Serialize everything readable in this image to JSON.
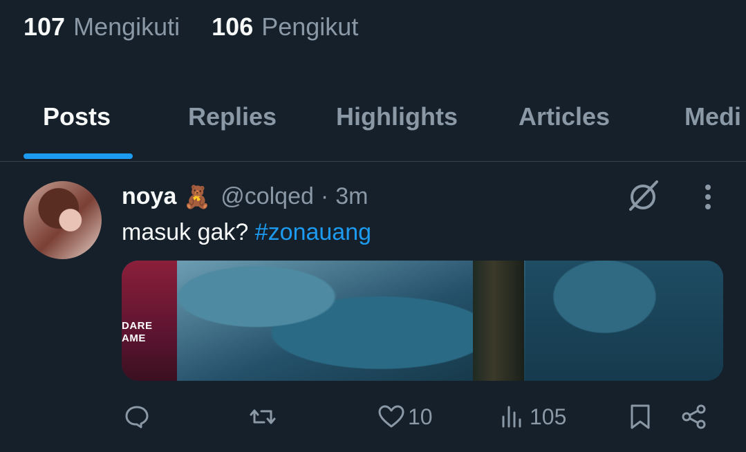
{
  "profile": {
    "following_count": "107",
    "following_label": "Mengikuti",
    "followers_count": "106",
    "followers_label": "Pengikut"
  },
  "tabs": [
    {
      "label": "Posts",
      "active": true
    },
    {
      "label": "Replies",
      "active": false
    },
    {
      "label": "Highlights",
      "active": false
    },
    {
      "label": "Articles",
      "active": false
    },
    {
      "label": "Medi",
      "active": false
    }
  ],
  "post": {
    "display_name": "noya",
    "name_emoji": "🧸",
    "handle": "@colqed",
    "separator": "·",
    "time": "3m",
    "text": "masuk gak? ",
    "hashtag": "#zonauang",
    "media_overlay_text_line1": "DARE",
    "media_overlay_text_line2": "AME",
    "likes": "10",
    "views": "105"
  },
  "icons": {
    "grok": "grok-icon",
    "more": "more-icon",
    "reply": "reply-icon",
    "repost": "repost-icon",
    "like": "heart-icon",
    "views": "views-icon",
    "bookmark": "bookmark-icon",
    "share": "share-icon"
  },
  "colors": {
    "background": "#15202b",
    "accent": "#1d9bf0",
    "muted": "#8b98a5",
    "text": "#f7f9f9"
  }
}
